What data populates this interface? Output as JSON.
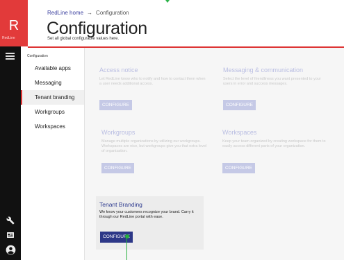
{
  "brand": {
    "logo_letter": "R",
    "logo_name": "RedLine",
    "accent": "#e23a3a"
  },
  "header": {
    "breadcrumb": {
      "home": "RedLine home",
      "separator": "→",
      "current": "Configuration"
    },
    "title": "Configuration",
    "subtitle": "Set all global configurable values here."
  },
  "rail": {
    "icons": [
      "hamburger-menu-icon",
      "wrench-icon",
      "id-card-icon",
      "user-account-icon"
    ]
  },
  "nav": {
    "heading": "Configuration",
    "items": [
      {
        "label": "Available apps"
      },
      {
        "label": "Messaging"
      },
      {
        "label": "Tenant branding",
        "active": true
      },
      {
        "label": "Workgroups"
      },
      {
        "label": "Workspaces"
      }
    ]
  },
  "cards": {
    "access": {
      "title": "Access notice",
      "desc": "Let RedLine know who to notify and how to contact them when a user needs additional access.",
      "button": "CONFIGURE"
    },
    "messaging": {
      "title": "Messaging & communication",
      "desc": "Select the level of friendliness you want presented to your users in error and success messages.",
      "button": "CONFIGURE"
    },
    "workgroups": {
      "title": "Workgroups",
      "desc": "Manage multiple organizations by utilizing our workgroups. Workspaces are nice, but workgroups give you that extra level of organization.",
      "button": "CONFIGURE"
    },
    "workspaces": {
      "title": "Workspaces",
      "desc": "Keep your team organized by creating workspace for them to easily access different parts of your organization.",
      "button": "CONFIGURE"
    },
    "tenant": {
      "title": "Tenant Branding",
      "desc": "We know your customers recognize your brand. Carry it through our RedLine portal with ease.",
      "button": "CONFIGURE"
    }
  }
}
